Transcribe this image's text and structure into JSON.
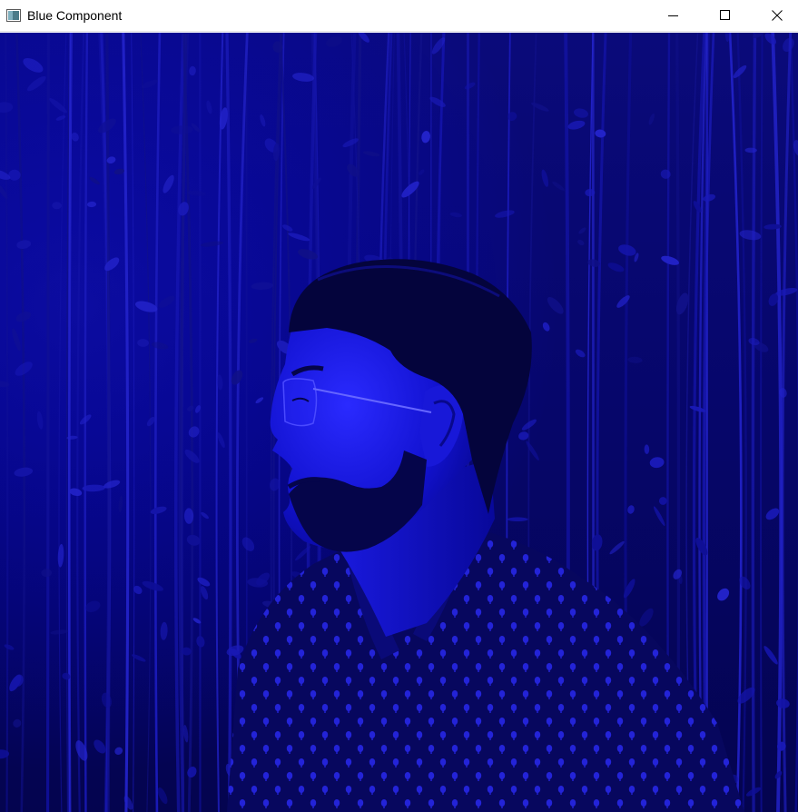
{
  "window": {
    "title": "Blue Component"
  },
  "controls": {
    "minimize_icon": "minimize-icon",
    "maximize_icon": "maximize-icon",
    "close_icon": "close-icon"
  },
  "image": {
    "channel": "blue",
    "channel_color": "#0000ff",
    "subject": "man-profile-portrait-with-glasses-and-beard",
    "background": "hanging-vines"
  }
}
